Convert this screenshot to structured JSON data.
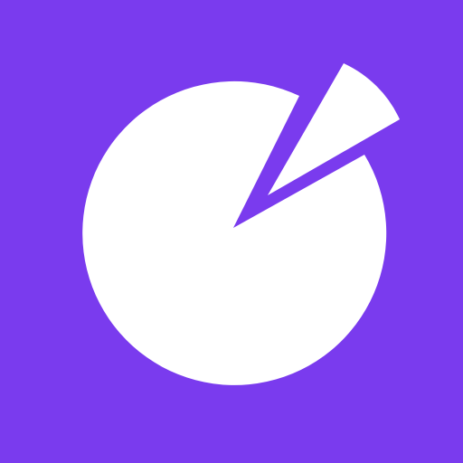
{
  "icon": {
    "name": "pie-chart-icon",
    "background_color": "#7A3BEE",
    "foreground_color": "#FFFFFF"
  }
}
